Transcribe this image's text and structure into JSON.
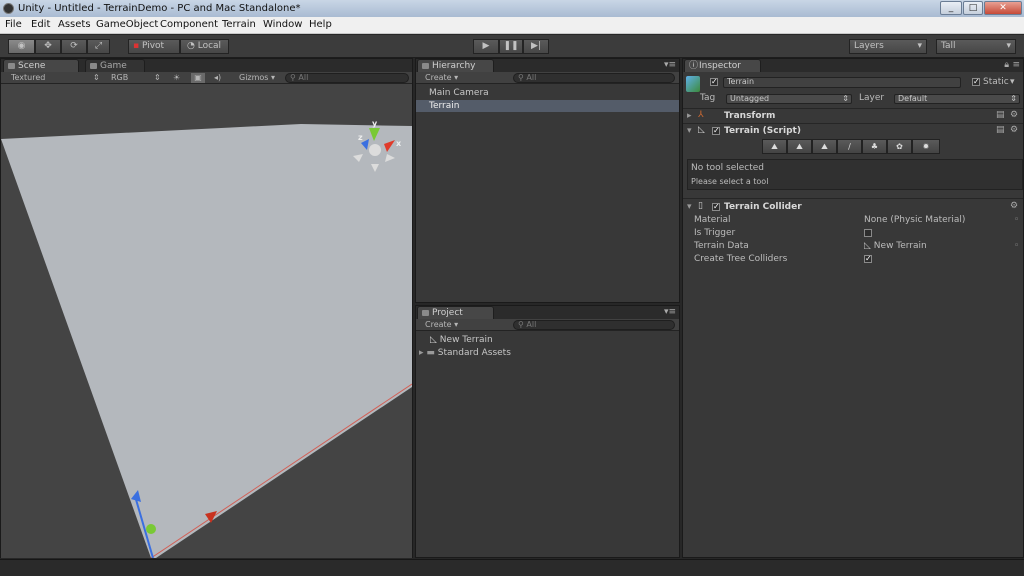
{
  "window": {
    "title": "Unity - Untitled - TerrainDemo - PC and Mac Standalone*"
  },
  "menu": [
    "File",
    "Edit",
    "Assets",
    "GameObject",
    "Component",
    "Terrain",
    "Window",
    "Help"
  ],
  "toolbar": {
    "pivot": "Pivot",
    "local": "Local",
    "layers": "Layers",
    "layout": "Tall"
  },
  "scene": {
    "tab_scene": "Scene",
    "tab_game": "Game",
    "shading": "Textured",
    "render_mode": "RGB",
    "gizmos": "Gizmos",
    "search_placeholder": "All",
    "gizmo_axes": {
      "y": "y",
      "x": "x",
      "z": "z"
    }
  },
  "hierarchy": {
    "tab": "Hierarchy",
    "create": "Create",
    "search_placeholder": "All",
    "items": [
      {
        "label": "Main Camera",
        "selected": false
      },
      {
        "label": "Terrain",
        "selected": true
      }
    ]
  },
  "project": {
    "tab": "Project",
    "create": "Create",
    "search_placeholder": "All",
    "items": [
      {
        "label": "New Terrain",
        "icon": "terrain-asset-icon"
      },
      {
        "label": "Standard Assets",
        "icon": "folder-icon"
      }
    ]
  },
  "inspector": {
    "tab": "Inspector",
    "object_name": "Terrain",
    "static_label": "Static",
    "tag_label": "Tag",
    "tag_value": "Untagged",
    "layer_label": "Layer",
    "layer_value": "Default",
    "transform": "Transform",
    "terrain_script": "Terrain (Script)",
    "tool_info": {
      "line1": "No tool selected",
      "line2": "Please select a tool"
    },
    "collider": {
      "title": "Terrain Collider",
      "material_label": "Material",
      "material_value": "None (Physic Material)",
      "trigger_label": "Is Trigger",
      "terrain_data_label": "Terrain Data",
      "terrain_data_value": "New Terrain",
      "tree_colliders_label": "Create Tree Colliders"
    }
  },
  "colors": {
    "terrain": "#b4b8bd",
    "x_axis": "#e03a2a",
    "y_axis": "#79c935",
    "z_axis": "#3a6fe0",
    "selection": "#545c69"
  }
}
